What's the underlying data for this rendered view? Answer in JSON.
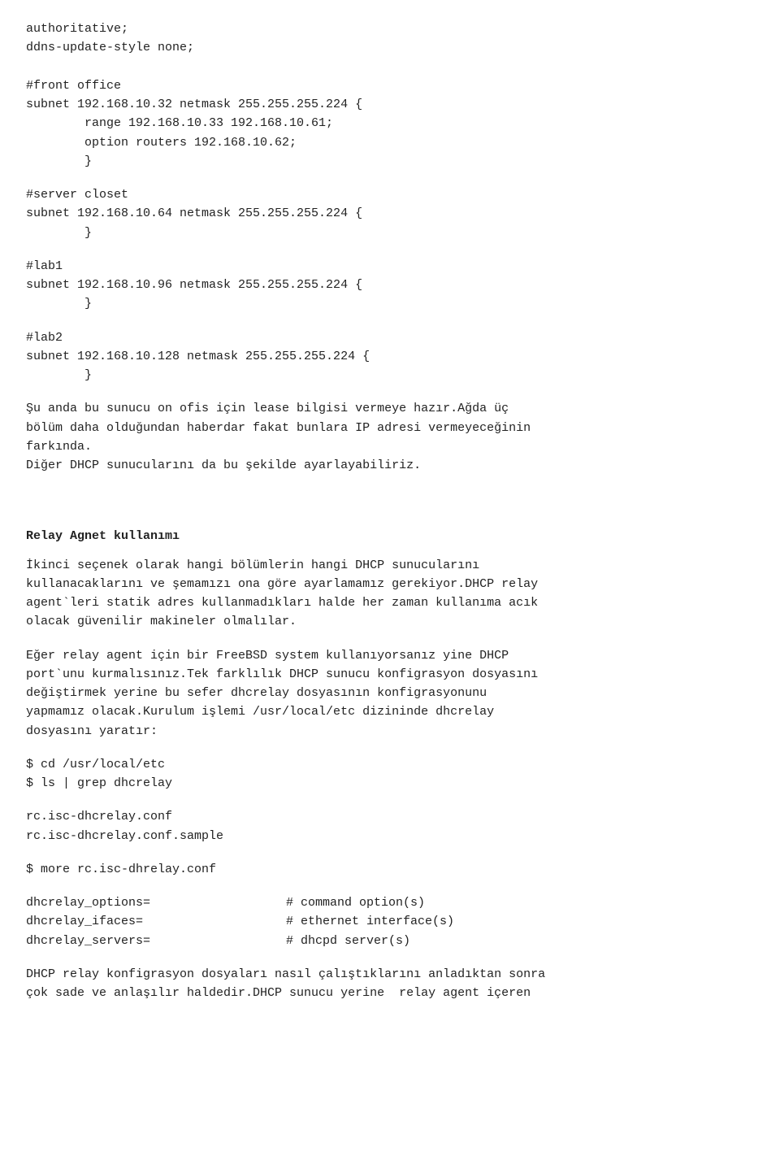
{
  "content": {
    "code_section_1": "authoritative;\nddns-update-style none;\n\n#front office\nsubnet 192.168.10.32 netmask 255.255.255.224 {\n        range 192.168.10.33 192.168.10.61;\n        option routers 192.168.10.62;\n        }",
    "code_section_2": "#server closet\nsubnet 192.168.10.64 netmask 255.255.255.224 {\n        }",
    "code_section_3": "#lab1\nsubnet 192.168.10.96 netmask 255.255.255.224 {\n        }",
    "code_section_4": "#lab2\nsubnet 192.168.10.128 netmask 255.255.255.224 {\n        }",
    "prose_1": "Şu anda bu sunucu on ofis için lease bilgisi vermeye hazır.Ağda üç\nbölüm daha olduğundan haberdar fakat bunlara IP adresi vermeyeceğinin\nfarkında.\nDiğer DHCP sunucularını da bu şekilde ayarlayabiliriz.",
    "relay_heading": "Relay Agnet kullanımı",
    "prose_2": "İkinci seçenek olarak hangi bölümlerin hangi DHCP sunucularını\nkullanacaklarını ve şemamızı ona göre ayarlamamız gerekiyor.DHCP relay\nagent`leri statik adres kullanmadıkları halde her zaman kullanıma acık\nolacak güvenilir makineler olmalılar.",
    "prose_3": "Eğer relay agent için bir FreeBSD system kullanıyorsanız yine DHCP\nport`unu kurmalısınız.Tek farklılık DHCP sunucu konfigrasyon dosyasını\ndeğiştirmek yerine bu sefer dhcrelay dosyasının konfigrasyonunu\nyapmamız olacak.Kurulum işlemi /usr/local/etc dizininde dhcrelay\ndosyasını yaratır:",
    "code_section_5": "$ cd /usr/local/etc\n$ ls | grep dhcrelay",
    "code_section_6": "rc.isc-dhcrelay.conf\nrc.isc-dhcrelay.conf.sample",
    "code_section_7": "$ more rc.isc-dhrelay.conf",
    "code_section_8_col1": "dhcrelay_options=\ndhcrelay_ifaces=\ndhcrelay_servers=",
    "code_section_8_col2": "# command option(s)\n# ethernet interface(s)\n# dhcpd server(s)",
    "prose_4": "DHCP relay konfigrasyon dosyaları nasıl çalıştıklarını anladıktan sonra\nçok sade ve anlaşılır haldedir.DHCP sunucu yerine  relay agent içeren"
  }
}
